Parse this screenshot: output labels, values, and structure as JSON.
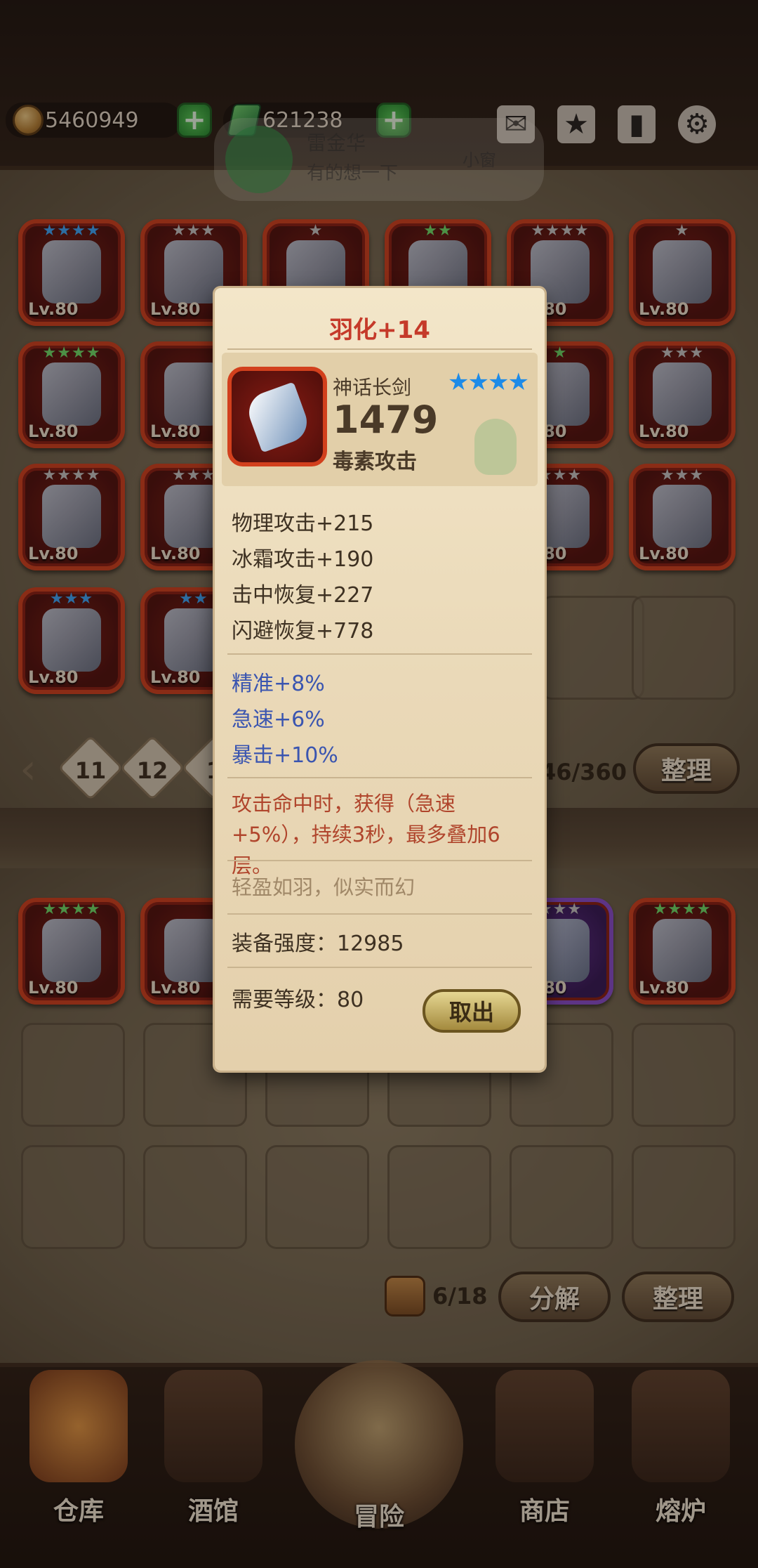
{
  "currency": {
    "gold": "5460949",
    "gems": "621238"
  },
  "toast": {
    "name": "雷金华",
    "message": "有的想一下",
    "tag": "小窗"
  },
  "top_icons": [
    "mail-icon",
    "star-shield-icon",
    "bookmark-box-icon",
    "gear-icon"
  ],
  "level_label": "Lv.80",
  "upper_grid": {
    "rows": [
      [
        {
          "stars": "★★★★",
          "star_color": "blue"
        },
        {
          "stars": "★★★",
          "star_color": "grey"
        },
        {
          "stars": "★",
          "star_color": "grey"
        },
        {
          "stars": "★★",
          "star_color": "green"
        },
        {
          "stars": "★★★★",
          "star_color": "grey"
        },
        {
          "stars": "★",
          "star_color": "grey"
        }
      ],
      [
        {
          "stars": "★★★★",
          "star_color": "green"
        },
        {
          "stars": "",
          "star_color": "grey"
        },
        {
          "stars": "",
          "star_color": "grey"
        },
        {
          "stars": "",
          "star_color": "grey"
        },
        {
          "stars": "★",
          "star_color": "green"
        },
        {
          "stars": "★★★",
          "star_color": "grey"
        }
      ],
      [
        {
          "stars": "★★★★",
          "star_color": "grey"
        },
        {
          "stars": "★★★",
          "star_color": "grey"
        },
        {
          "stars": "",
          "star_color": "grey"
        },
        {
          "stars": "",
          "star_color": "grey"
        },
        {
          "stars": "★★★",
          "star_color": "grey"
        },
        {
          "stars": "★★★",
          "star_color": "grey"
        }
      ],
      [
        {
          "stars": "★★★",
          "star_color": "blue"
        },
        {
          "stars": "★★",
          "star_color": "blue"
        }
      ]
    ]
  },
  "paging": {
    "pages": [
      "11",
      "12",
      "1"
    ],
    "count": "46/360",
    "sort_label": "整理"
  },
  "lower_grid": {
    "items": [
      {
        "stars": "★★★★",
        "star_color": "green",
        "purple": false
      },
      {
        "stars": "",
        "star_color": "grey",
        "purple": false
      },
      {
        "stars": "★★★",
        "star_color": "grey",
        "purple": true
      },
      {
        "stars": "★★★★",
        "star_color": "green",
        "purple": false
      }
    ],
    "count": "6/18",
    "decompose_label": "分解",
    "sort_label": "整理"
  },
  "nav": [
    {
      "label": "仓库",
      "icon": "warehouse-icon"
    },
    {
      "label": "酒馆",
      "icon": "beer-mug-icon"
    },
    {
      "label": "冒险",
      "icon": "adventure-icon"
    },
    {
      "label": "商店",
      "icon": "shop-icon"
    },
    {
      "label": "熔炉",
      "icon": "furnace-icon"
    }
  ],
  "modal": {
    "title": "羽化+14",
    "item_name": "神话长剑",
    "stars": "★★★★",
    "power": "1479",
    "element": "毒素攻击",
    "stats": [
      "物理攻击+215",
      "冰霜攻击+190",
      "击中恢复+227",
      "闪避恢复+778"
    ],
    "bonus_stats": [
      "精准+8%",
      "急速+6%",
      "暴击+10%"
    ],
    "effect": "攻击命中时，获得（急速+5%），持续3秒，最多叠加6层。",
    "flavor": "轻盈如羽，似实而幻",
    "strength": "装备强度：12985",
    "required_level": "需要等级：80",
    "take_out_label": "取出"
  },
  "colors": {
    "accent_red": "#c53a2a",
    "bonus_blue": "#3a55b0",
    "effect_red": "#b0452c",
    "star_blue": "#1d8be8"
  }
}
